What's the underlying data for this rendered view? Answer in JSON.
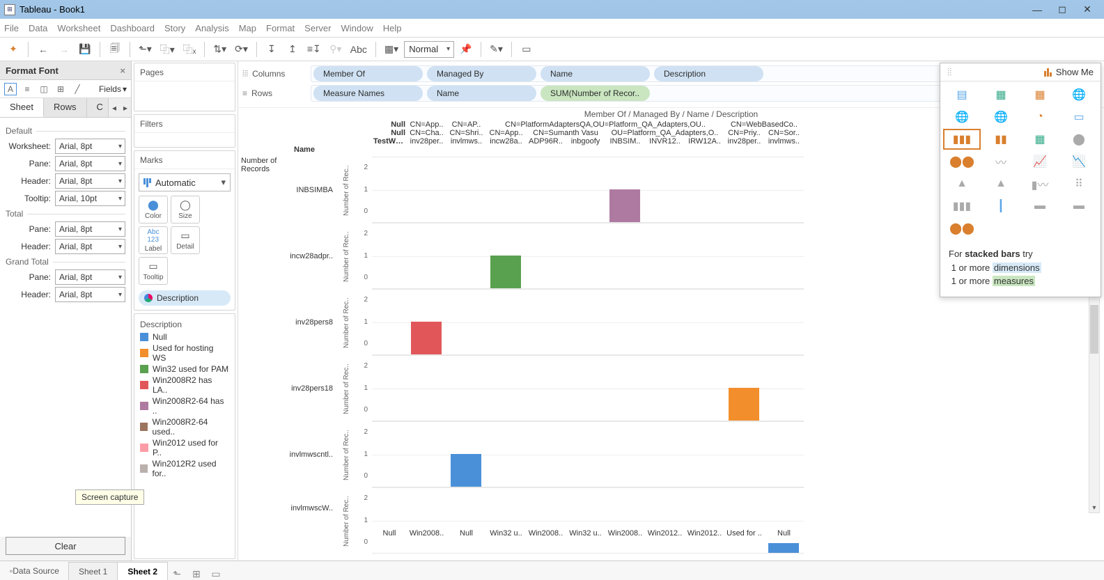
{
  "window": {
    "title": "Tableau - Book1"
  },
  "menus": [
    "File",
    "Data",
    "Worksheet",
    "Dashboard",
    "Story",
    "Analysis",
    "Map",
    "Format",
    "Server",
    "Window",
    "Help"
  ],
  "toolbar": {
    "view_mode": "Normal"
  },
  "format_panel": {
    "title": "Format Font",
    "fields_label": "Fields",
    "tabs": [
      "Sheet",
      "Rows",
      "C"
    ],
    "active_tab": "Sheet",
    "groups": {
      "default": "Default",
      "total": "Total",
      "grand_total": "Grand Total"
    },
    "rows": {
      "worksheet_label": "Worksheet:",
      "worksheet_value": "Arial, 8pt",
      "pane_label": "Pane:",
      "pane_value": "Arial, 8pt",
      "header_label": "Header:",
      "header_value": "Arial, 8pt",
      "tooltip_label": "Tooltip:",
      "tooltip_value": "Arial, 10pt",
      "total_pane_value": "Arial, 8pt",
      "total_header_value": "Arial, 8pt",
      "gt_pane_value": "Arial, 8pt",
      "gt_header_value": "Arial, 8pt"
    },
    "clear": "Clear",
    "screen_capture": "Screen capture"
  },
  "cards": {
    "pages": "Pages",
    "filters": "Filters",
    "marks": "Marks",
    "marks_type": "Automatic",
    "btns": {
      "color": "Color",
      "size": "Size",
      "label": "Label",
      "detail": "Detail",
      "tooltip": "Tooltip"
    },
    "desc_pill": "Description",
    "legend": {
      "title": "Description",
      "items": [
        {
          "label": "Null",
          "color": "#4a90d9"
        },
        {
          "label": "Used for hosting WS",
          "color": "#f28e2b"
        },
        {
          "label": "Win32 used for PAM",
          "color": "#59a14f"
        },
        {
          "label": "Win2008R2 has LA..",
          "color": "#e15759"
        },
        {
          "label": "Win2008R2-64 has ..",
          "color": "#af7aa1"
        },
        {
          "label": "Win2008R2-64 used..",
          "color": "#9c755f"
        },
        {
          "label": "Win2012 used for P..",
          "color": "#ff9da7"
        },
        {
          "label": "Win2012R2 used for..",
          "color": "#bab0ac"
        }
      ]
    }
  },
  "shelves": {
    "columns_label": "Columns",
    "rows_label": "Rows",
    "columns": [
      "Member Of",
      "Managed By",
      "Name",
      "Description"
    ],
    "rows": [
      "Measure Names",
      "Name",
      "SUM(Number of Recor.."
    ]
  },
  "viz": {
    "crumbs": "Member Of  /  Managed By  /  Name  /  Description",
    "name_header": "Name",
    "rowgroup": "Number of Records",
    "row_names": [
      "INBSIMBA",
      "incw28adpr..",
      "inv28pers8",
      "inv28pers18",
      "invlmwscntl..",
      "invlmwscW.."
    ],
    "col_lvl1": [
      "Null",
      "CN=App..",
      "CN=AP..",
      "CN=PlatformAdaptersQA,OU=Platform_QA_Adapters,OU..",
      "CN=WebBasedCo.."
    ],
    "col_lvl2": [
      "Null",
      "CN=Cha..",
      "CN=Shri..",
      "CN=App..",
      "CN=Sumanth Vasu",
      "OU=Platform_QA_Adapters,O..",
      "CN=Priy..",
      "CN=Sor.."
    ],
    "col_lvl3": [
      "TestWrite",
      "inv28per..",
      "invlmws..",
      "incw28a..",
      "ADP96R..",
      "inbgoofy",
      "INBSIM..",
      "INVR12..",
      "IRW12A..",
      "inv28per..",
      "invlmws.."
    ],
    "xfoot": [
      "Null",
      "Win2008..",
      "Null",
      "Win32 u..",
      "Win2008..",
      "Win32 u..",
      "Win2008..",
      "Win2012..",
      "Win2012..",
      "Used for ..",
      "Null"
    ],
    "y_ticks": [
      "2",
      "1",
      "0"
    ],
    "y_axis_label": "Number of Rec.."
  },
  "showme": {
    "title": "Show Me",
    "footer_prefix": "For ",
    "footer_bold": "stacked bars",
    "footer_suffix": " try",
    "line1a": "1 or more ",
    "line1b": "dimensions",
    "line2a": "1 or more ",
    "line2b": "measures"
  },
  "tabs": {
    "data_source": "Data Source",
    "sheet1": "Sheet 1",
    "sheet2": "Sheet 2"
  },
  "chart_data": {
    "type": "bar",
    "ylabel": "Number of Records",
    "ylim": [
      0,
      2
    ],
    "row_dimension": "Name",
    "rows": [
      "INBSIMBA",
      "incw28adpr..",
      "inv28pers8",
      "inv28pers18",
      "invlmwscntl..",
      "invlmwscW.."
    ],
    "column_dimension": "Name (column)",
    "columns": [
      "TestWrite",
      "inv28per..",
      "invlmws..",
      "incw28a..",
      "ADP96R..",
      "inbgoofy",
      "INBSIM..",
      "INVR12..",
      "IRW12A..",
      "inv28per..",
      "invlmws.."
    ],
    "color_dimension": "Description",
    "bars": [
      {
        "row": "INBSIMBA",
        "col_index": 6,
        "value": 1,
        "description": "Win2008R2-64 has ..",
        "color": "#af7aa1"
      },
      {
        "row": "incw28adpr..",
        "col_index": 3,
        "value": 1,
        "description": "Win32 used for PAM",
        "color": "#59a14f"
      },
      {
        "row": "inv28pers8",
        "col_index": 1,
        "value": 1,
        "description": "Win2008R2 has LA..",
        "color": "#e15759"
      },
      {
        "row": "inv28pers18",
        "col_index": 9,
        "value": 1,
        "description": "Used for hosting WS",
        "color": "#f28e2b"
      },
      {
        "row": "invlmwscntl..",
        "col_index": 2,
        "value": 1,
        "description": "Null",
        "color": "#4a90d9"
      },
      {
        "row": "invlmwscW..",
        "col_index": 10,
        "value": 0.3,
        "description": "Null",
        "color": "#4a90d9"
      }
    ]
  }
}
